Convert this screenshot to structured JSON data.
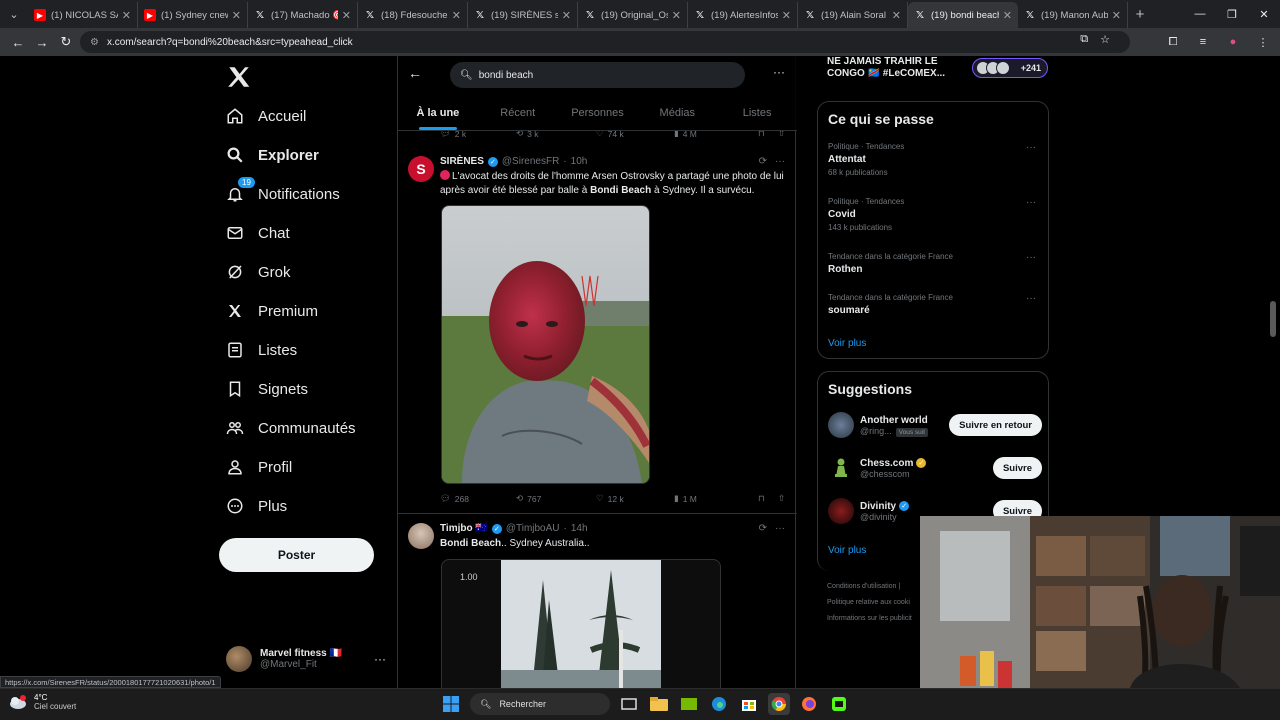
{
  "browser": {
    "tabs": [
      {
        "title": "(1) NICOLAS SARA",
        "icon": "youtube-icon"
      },
      {
        "title": "(1) Sydney cnews",
        "icon": "youtube-icon"
      },
      {
        "title": "(17) Machado 🎯",
        "icon": "x-icon"
      },
      {
        "title": "(18) Fdesouche.co",
        "icon": "x-icon"
      },
      {
        "title": "(19) SIRÈNES sur X",
        "icon": "x-icon"
      },
      {
        "title": "(19) Original_Osm",
        "icon": "x-icon"
      },
      {
        "title": "(19) AlertesInfos s",
        "icon": "x-icon"
      },
      {
        "title": "(19) Alain Soral O",
        "icon": "x-icon"
      },
      {
        "title": "(19) bondi beach",
        "icon": "x-icon",
        "active": true
      },
      {
        "title": "(19) Manon Aubry",
        "icon": "x-icon"
      }
    ],
    "url": "x.com/search?q=bondi%20beach&src=typeahead_click"
  },
  "nav": {
    "items": [
      {
        "label": "Accueil",
        "icon": "home-icon"
      },
      {
        "label": "Explorer",
        "icon": "search-icon",
        "active": true
      },
      {
        "label": "Notifications",
        "icon": "bell-icon",
        "badge": "19"
      },
      {
        "label": "Chat",
        "icon": "mail-icon"
      },
      {
        "label": "Grok",
        "icon": "grok-icon"
      },
      {
        "label": "Premium",
        "icon": "x-premium-icon"
      },
      {
        "label": "Listes",
        "icon": "list-icon"
      },
      {
        "label": "Signets",
        "icon": "bookmark-icon"
      },
      {
        "label": "Communautés",
        "icon": "communities-icon"
      },
      {
        "label": "Profil",
        "icon": "profile-icon"
      },
      {
        "label": "Plus",
        "icon": "more-circle-icon"
      }
    ],
    "post_label": "Poster",
    "account": {
      "name": "Marvel fitness 🇫🇷",
      "handle": "@Marvel_Fit"
    }
  },
  "search": {
    "query": "bondi beach",
    "tabs": [
      "À la une",
      "Récent",
      "Personnes",
      "Médias",
      "Listes"
    ]
  },
  "prev_tweet_stats": {
    "replies": "2 k",
    "reposts": "3 k",
    "likes": "74 k",
    "views": "4 M"
  },
  "tweets": [
    {
      "name": "SIRÈNES",
      "handle": "@SirenesFR",
      "time": "10h",
      "text_pre": "L'avocat des droits de l'homme Arsen Ostrovsky a partagé une photo de lui après avoir été blessé par balle à ",
      "text_bold": "Bondi Beach",
      "text_post": " à Sydney. Il a survécu.",
      "stats": {
        "replies": "268",
        "reposts": "767",
        "likes": "12 k",
        "views": "1 M"
      }
    },
    {
      "name": "Timjbo 🇦🇺",
      "handle": "@TimjboAU",
      "time": "14h",
      "text_bold": "Bondi Beach",
      "text_post": ".. Sydney Australia..",
      "media_label": "1.00"
    }
  ],
  "right": {
    "promo_title": "NE JAMAIS TRAHIR LE CONGO 🇨🇩 #LeCOMEX...",
    "promo_count": "+241",
    "trends_title": "Ce qui se passe",
    "trends": [
      {
        "category": "Politique · Tendances",
        "title": "Attentat",
        "count": "68 k publications"
      },
      {
        "category": "Politique · Tendances",
        "title": "Covid",
        "count": "143 k publications"
      },
      {
        "category": "Tendance dans la catégorie France",
        "title": "Rothen",
        "count": ""
      },
      {
        "category": "Tendance dans la catégorie France",
        "title": "soumaré",
        "count": ""
      }
    ],
    "see_more": "Voir plus",
    "suggestions_title": "Suggestions",
    "suggestions": [
      {
        "name": "Another world",
        "handle": "@ring...",
        "follows_you": "Vous suit",
        "button": "Suivre en retour"
      },
      {
        "name": "Chess.com",
        "handle": "@chesscom",
        "button": "Suivre"
      },
      {
        "name": "Divinity",
        "handle": "@divinity",
        "button": "Suivre"
      }
    ],
    "footer": [
      "Conditions d'utilisation |",
      "Politique relative aux cooki",
      "Informations sur les publicit"
    ]
  },
  "status_url": "https://x.com/SirenesFR/status/2000180177721020631/photo/1",
  "taskbar": {
    "temp": "4°C",
    "weather": "Ciel couvert",
    "search_placeholder": "Rechercher"
  },
  "colors": {
    "accent": "#1d9bf0",
    "bg": "#000000",
    "muted": "#71767b"
  }
}
